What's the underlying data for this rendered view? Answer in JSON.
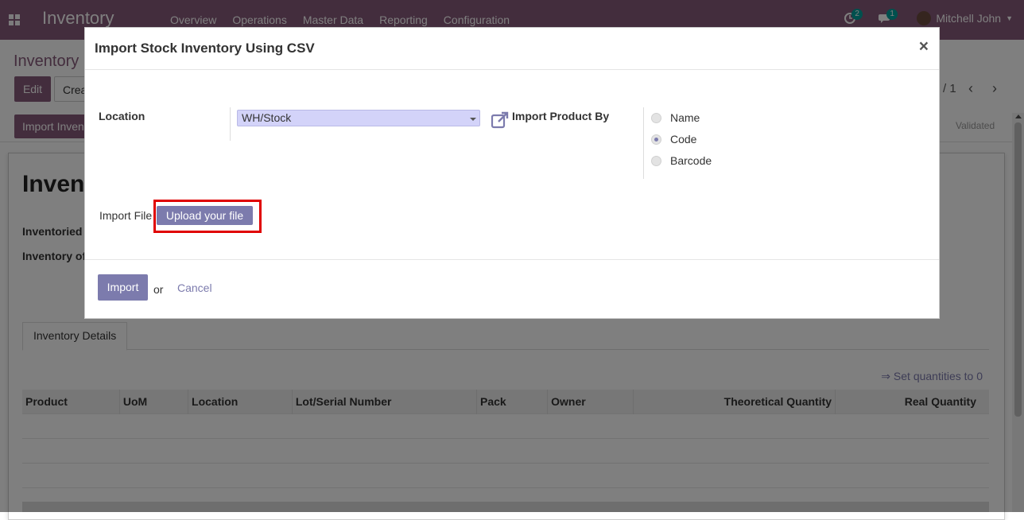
{
  "navbar": {
    "app_name": "Inventory",
    "menu": [
      "Overview",
      "Operations",
      "Master Data",
      "Reporting",
      "Configuration"
    ],
    "activity_count": "2",
    "message_count": "1",
    "user_name": "Mitchell John"
  },
  "control_panel": {
    "title": "Inventory",
    "edit_label": "Edit",
    "create_label": "Crea",
    "pager": "/ 1",
    "import_button_label": "Import Inven",
    "status_validated": "Validated"
  },
  "sheet": {
    "title": "Invent",
    "field1_label": "Inventoried",
    "field2_label": "Inventory of",
    "tab_label": "Inventory Details",
    "set_quantities_link": "⇒ Set quantities to 0",
    "columns": [
      "Product",
      "UoM",
      "Location",
      "Lot/Serial Number",
      "Pack",
      "Owner",
      "Theoretical Quantity",
      "Real Quantity"
    ]
  },
  "modal": {
    "title": "Import Stock Inventory Using CSV",
    "close_symbol": "×",
    "location_label": "Location",
    "location_value": "WH/Stock",
    "import_by_label": "Import Product By",
    "import_by_options": [
      {
        "label": "Name",
        "checked": false
      },
      {
        "label": "Code",
        "checked": true
      },
      {
        "label": "Barcode",
        "checked": false
      }
    ],
    "import_file_label": "Import File",
    "upload_label": "Upload your file",
    "import_label": "Import",
    "or_text": "or",
    "cancel_label": "Cancel"
  },
  "colors": {
    "navbar": "#875a7b",
    "accent": "#7c7bad",
    "highlight": "#e00000"
  }
}
